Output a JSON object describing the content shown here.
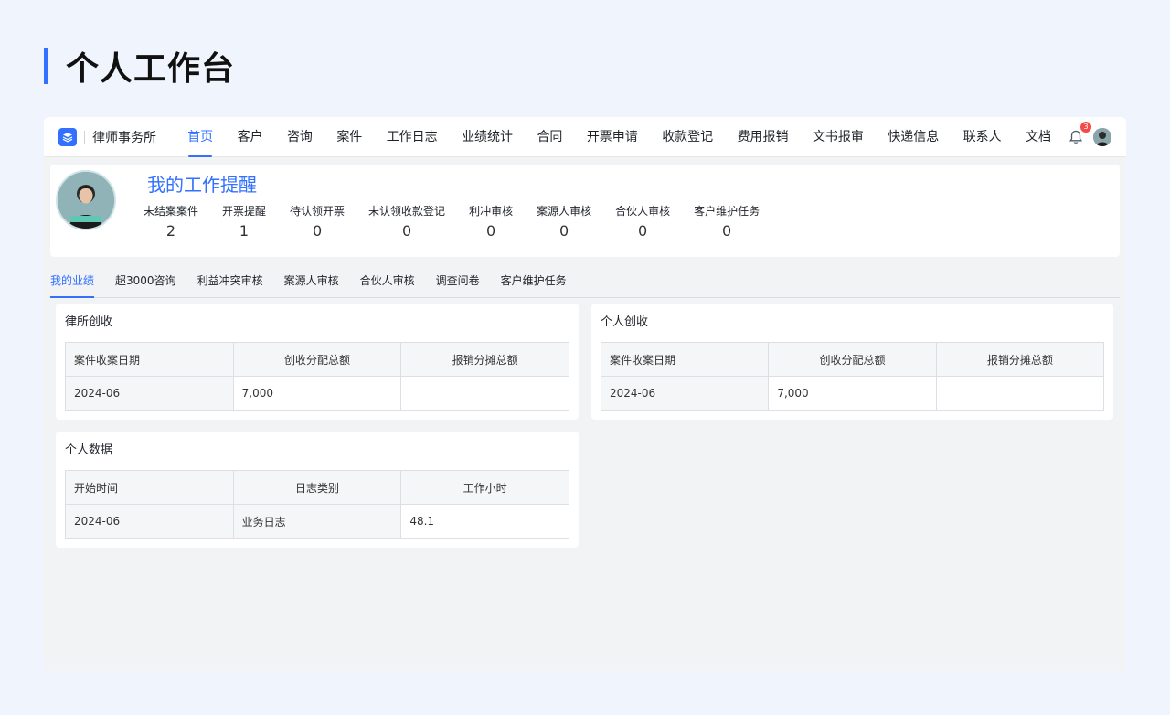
{
  "page": {
    "title": "个人工作台"
  },
  "nav": {
    "brand": "律师事务所",
    "items": [
      "首页",
      "客户",
      "咨询",
      "案件",
      "工作日志",
      "业绩统计",
      "合同",
      "开票申请",
      "收款登记",
      "费用报销",
      "文书报审",
      "快递信息",
      "联系人",
      "文档"
    ],
    "active_index": 0,
    "notification_count": "3"
  },
  "reminder": {
    "title": "我的工作提醒",
    "stats": [
      {
        "label": "未结案案件",
        "value": "2"
      },
      {
        "label": "开票提醒",
        "value": "1"
      },
      {
        "label": "待认领开票",
        "value": "0"
      },
      {
        "label": "未认领收款登记",
        "value": "0"
      },
      {
        "label": "利冲审核",
        "value": "0"
      },
      {
        "label": "案源人审核",
        "value": "0"
      },
      {
        "label": "合伙人审核",
        "value": "0"
      },
      {
        "label": "客户维护任务",
        "value": "0"
      }
    ]
  },
  "tabs": {
    "items": [
      "我的业绩",
      "超3000咨询",
      "利益冲突审核",
      "案源人审核",
      "合伙人审核",
      "调查问卷",
      "客户维护任务"
    ],
    "active_index": 0
  },
  "cards": {
    "firm_revenue": {
      "title": "律所创收",
      "headers": [
        "案件收案日期",
        "创收分配总额",
        "报销分摊总额"
      ],
      "rows": [
        [
          "2024-06",
          "7,000",
          ""
        ]
      ]
    },
    "personal_revenue": {
      "title": "个人创收",
      "headers": [
        "案件收案日期",
        "创收分配总额",
        "报销分摊总额"
      ],
      "rows": [
        [
          "2024-06",
          "7,000",
          ""
        ]
      ]
    },
    "personal_data": {
      "title": "个人数据",
      "headers": [
        "开始时间",
        "日志类别",
        "工作小时"
      ],
      "rows": [
        [
          "2024-06",
          "业务日志",
          "48.1"
        ]
      ]
    }
  },
  "colors": {
    "accent": "#3370ff",
    "badge": "#f54a45"
  }
}
